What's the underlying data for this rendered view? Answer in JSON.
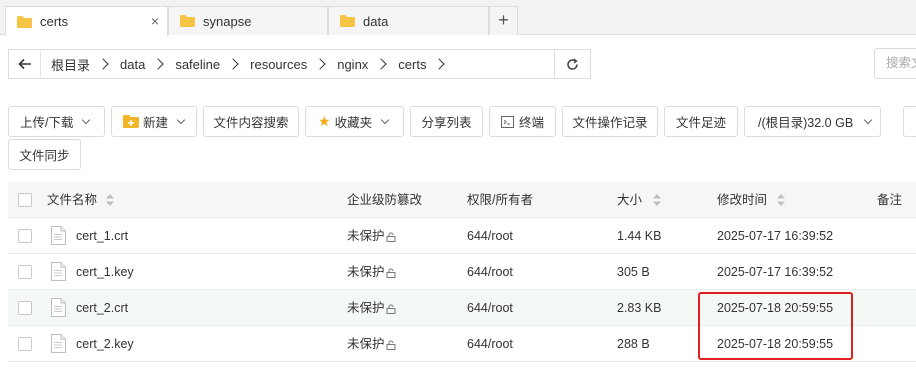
{
  "tabs": [
    {
      "label": "certs",
      "close": "×"
    },
    {
      "label": "synapse"
    },
    {
      "label": "data"
    }
  ],
  "tab_add": "+",
  "breadcrumbs": [
    "根目录",
    "data",
    "safeline",
    "resources",
    "nginx",
    "certs"
  ],
  "search": {
    "placeholder": "搜索文件"
  },
  "toolbar": {
    "upload": "上传/下载",
    "new": "新建",
    "content_search": "文件内容搜索",
    "favorites": "收藏夹",
    "share_list": "分享列表",
    "terminal": "终端",
    "op_log": "文件操作记录",
    "footprint": "文件足迹",
    "disk": "/(根目录)32.0 GB",
    "sync": "文件同步"
  },
  "table": {
    "headers": {
      "name": "文件名称",
      "protect": "企业级防篡改",
      "perm": "权限/所有者",
      "size": "大小",
      "mtime": "修改时间",
      "note": "备注"
    },
    "rows": [
      {
        "name": "cert_1.crt",
        "protect": "未保护",
        "perm": "644/root",
        "size": "1.44 KB",
        "mtime": "2025-07-17 16:39:52"
      },
      {
        "name": "cert_1.key",
        "protect": "未保护",
        "perm": "644/root",
        "size": "305 B",
        "mtime": "2025-07-17 16:39:52"
      },
      {
        "name": "cert_2.crt",
        "protect": "未保护",
        "perm": "644/root",
        "size": "2.83 KB",
        "mtime": "2025-07-18 20:59:55"
      },
      {
        "name": "cert_2.key",
        "protect": "未保护",
        "perm": "644/root",
        "size": "288 B",
        "mtime": "2025-07-18 20:59:55"
      }
    ]
  },
  "colors": {
    "folder": "#f7c545",
    "highlight_box": "#e02020",
    "row_highlight": "#f4f9f6"
  }
}
